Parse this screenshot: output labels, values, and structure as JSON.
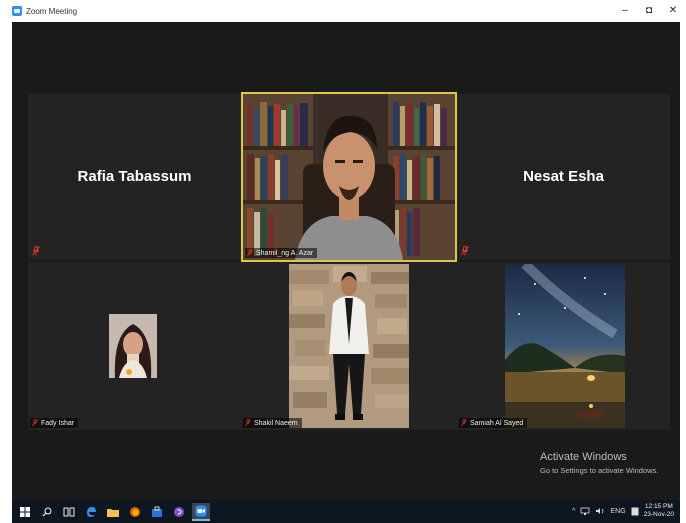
{
  "window": {
    "title": "Zoom Meeting",
    "minimize_glyph": "–",
    "maximize_glyph": "◘",
    "close_glyph": "✕"
  },
  "participants": [
    {
      "id": "rafia",
      "display_name": "Rafia Tabassum",
      "video": false,
      "muted": true
    },
    {
      "id": "speaker",
      "display_name": "Shamil_ng A. Azar",
      "video": true,
      "muted": true,
      "active_speaker": true
    },
    {
      "id": "nesat",
      "display_name": "Nesat Esha",
      "video": false,
      "muted": true
    },
    {
      "id": "fairy",
      "display_name": "Fady Ishar",
      "video": true,
      "muted": true
    },
    {
      "id": "shakil",
      "display_name": "Shakil Naeem",
      "video": true,
      "muted": true
    },
    {
      "id": "samiah",
      "display_name": "Samiah Al Sayed",
      "video": true,
      "muted": true
    }
  ],
  "activation_notice": {
    "title": "Activate Windows",
    "subtitle": "Go to Settings to activate Windows."
  },
  "taskbar": {
    "icons": [
      "windows-start-icon",
      "search-icon",
      "task-view-icon",
      "edge-icon",
      "file-explorer-icon",
      "firefox-icon",
      "store-icon",
      "viber-icon",
      "zoom-icon"
    ],
    "tray_lang": "ENG",
    "clock_time": "12:15 PM",
    "clock_date": "23-Nov-20"
  },
  "colors": {
    "meeting_bg": "#1a1a1a",
    "tile_bg": "#232323",
    "active_border": "#d9c64a",
    "mute_red": "#e0382e",
    "taskbar_bg": "#0e1620"
  }
}
